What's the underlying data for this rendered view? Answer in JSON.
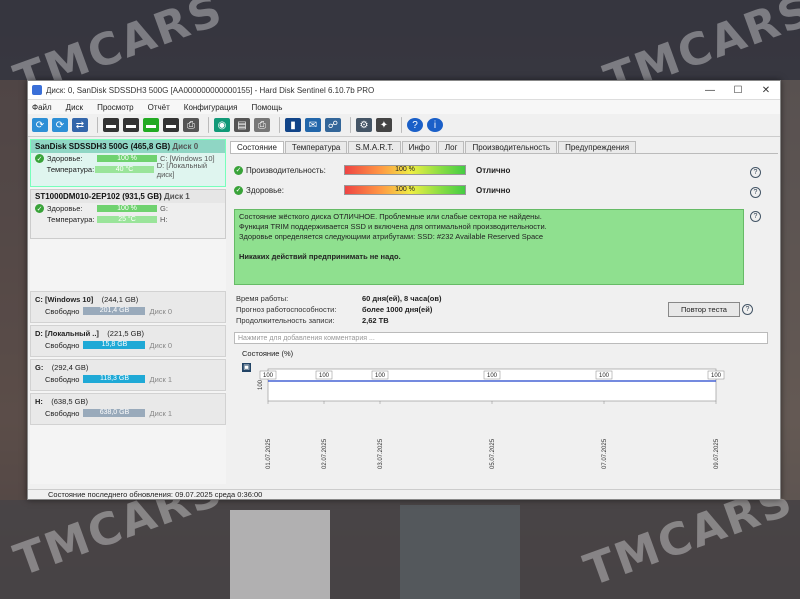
{
  "watermark": "TMCARS",
  "window": {
    "title": "Диск: 0, SanDisk SDSSDH3 500G [AA000000000000155] - Hard Disk Sentinel 6.10.7b PRO",
    "min": "—",
    "max": "☐",
    "close": "✕"
  },
  "menu": [
    "Файл",
    "Диск",
    "Просмотр",
    "Отчёт",
    "Конфигурация",
    "Помощь"
  ],
  "disks": [
    {
      "name": "SanDisk SDSSDH3 500G",
      "size": "(465,8 GB)",
      "disk": "Диск 0",
      "health_label": "Здоровье:",
      "health": "100 %",
      "health_side": "C: [Windows 10]",
      "temp_label": "Температура:",
      "temp": "40 °C",
      "temp_side": "D: [Локальный диск]"
    },
    {
      "name": "ST1000DM010-2EP102",
      "size": "(931,5 GB)",
      "disk": "Диск 1",
      "health_label": "Здоровье:",
      "health": "100 %",
      "health_side": "G:",
      "temp_label": "Температура:",
      "temp": "25 °C",
      "temp_side": "H:"
    }
  ],
  "volumes": [
    {
      "name": "C: [Windows 10]",
      "size": "(244,1 GB)",
      "free_label": "Свободно",
      "free": "201,4 GB",
      "disk": "Диск 0"
    },
    {
      "name": "D: [Локальный ..]",
      "size": "(221,5 GB)",
      "free_label": "Свободно",
      "free": "15,8 GB",
      "disk": "Диск 0"
    },
    {
      "name": "G:",
      "size": "(292,4 GB)",
      "free_label": "Свободно",
      "free": "118,3 GB",
      "disk": "Диск 1"
    },
    {
      "name": "H:",
      "size": "(638,5 GB)",
      "free_label": "Свободно",
      "free": "638,0 GB",
      "disk": "Диск 1"
    }
  ],
  "tabs": [
    "Состояние",
    "Температура",
    "S.M.A.R.T.",
    "Инфо",
    "Лог",
    "Производительность",
    "Предупреждения"
  ],
  "status": {
    "perf_label": "Производительность:",
    "perf_value": "100 %",
    "perf_text": "Отлично",
    "health_label": "Здоровье:",
    "health_value": "100 %",
    "health_text": "Отлично",
    "help": "?"
  },
  "message": {
    "line1": "Состояние жёсткого диска ОТЛИЧНОЕ. Проблемные или слабые сектора не найдены.",
    "line2": "Функция TRIM поддерживается SSD и включена для оптимальной производительности.",
    "line3": "Здоровье определяется следующими атрибутами: SSD: #232 Available Reserved Space",
    "line4": "Никаких действий предпринимать не надо."
  },
  "info": {
    "uptime_label": "Время работы:",
    "uptime": "60 дня(ей), 8 часа(ов)",
    "forecast_label": "Прогноз работоспособности:",
    "forecast": "более 1000 дня(ей)",
    "written_label": "Продолжительность записи:",
    "written": "2,62 TB",
    "retest_button": "Повтор теста"
  },
  "comment_placeholder": "Нажмите для добавления комментария ...",
  "chart_data": {
    "type": "line",
    "title": "Состояние (%)",
    "x": [
      "01.07.2025",
      "02.07.2025",
      "03.07.2025",
      "05.07.2025",
      "07.07.2025",
      "09.07.2025"
    ],
    "series": [
      {
        "values": [
          100,
          100,
          100,
          100,
          100,
          100
        ]
      }
    ],
    "ylabel": "100",
    "ylim": [
      0,
      100
    ]
  },
  "statusbar": "Состояние последнего обновления: 09.07.2025 среда 0:36:00",
  "colors": {
    "accent": "#3a6fd8",
    "good": "#6fd26f",
    "message_bg": "#8fe08f",
    "volume_bar": "#1fa9d6"
  }
}
